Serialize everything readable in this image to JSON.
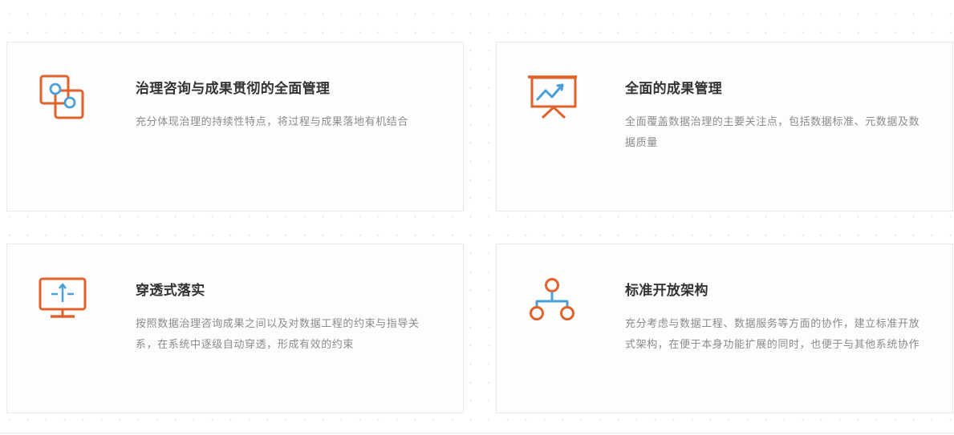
{
  "colors": {
    "accent_orange": "#e0612a",
    "accent_blue": "#4a9fd8",
    "title_text": "#333333",
    "desc_text": "#8a8a8a"
  },
  "features": [
    {
      "icon": "linked-squares-icon",
      "title": "治理咨询与成果贯彻的全面管理",
      "desc": "充分体现治理的持续性特点，将过程与成果落地有机结合"
    },
    {
      "icon": "presentation-chart-icon",
      "title": "全面的成果管理",
      "desc": "全面覆盖数据治理的主要关注点，包括数据标准、元数据及数据质量"
    },
    {
      "icon": "monitor-upload-icon",
      "title": "穿透式落实",
      "desc": "按照数据治理咨询成果之间以及对数据工程的约束与指导关系，在系统中逐级自动穿透，形成有效的约束"
    },
    {
      "icon": "hierarchy-network-icon",
      "title": "标准开放架构",
      "desc": "充分考虑与数据工程、数据服务等方面的协作，建立标准开放式架构，在便于本身功能扩展的同时，也便于与其他系统协作"
    }
  ]
}
